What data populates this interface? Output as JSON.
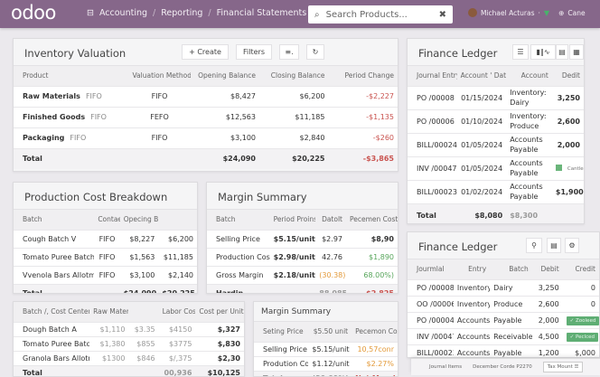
{
  "topbar": {
    "logo": "odoo",
    "breadcrumb": [
      "Accounting",
      "Reporting",
      "Financial Statements"
    ],
    "search_placeholder": "Search Products...",
    "user": "Michael Acturas",
    "company": "Cane",
    "brand_color": "#86678a"
  },
  "inventory": {
    "title": "Inventory Valuation",
    "create": "+ Create",
    "filters": "Filters",
    "columns": [
      "Product",
      "Valuation Method",
      "Opening Balance",
      "Closing Balance",
      "Period Change"
    ],
    "rows": [
      [
        {
          "v": "Raw Materials",
          "sub": "FIFO",
          "tone": "b"
        },
        {
          "v": "FIFO",
          "tone": "c"
        },
        {
          "v": "$8,427"
        },
        {
          "v": "$6,200"
        },
        {
          "v": "-$2,227",
          "tone": "neg"
        }
      ],
      [
        {
          "v": "Finished Goods",
          "sub": "FIFO",
          "tone": "b"
        },
        {
          "v": "FEFO",
          "tone": "c"
        },
        {
          "v": "$12,563"
        },
        {
          "v": "$11,185"
        },
        {
          "v": "-$1,135",
          "tone": "neg"
        }
      ],
      [
        {
          "v": "Packaging",
          "sub": "FIFO",
          "tone": "b"
        },
        {
          "v": "FIFO",
          "tone": "c"
        },
        {
          "v": "$3,100"
        },
        {
          "v": "$2,840"
        },
        {
          "v": "-$260",
          "tone": "neg"
        }
      ]
    ],
    "total": [
      {
        "v": "Total"
      },
      {
        "v": ""
      },
      {
        "v": "$24,090"
      },
      {
        "v": "$20,225"
      },
      {
        "v": "-$3,865",
        "tone": "neg"
      }
    ]
  },
  "ledger1": {
    "title": "Finance Ledger",
    "columns": [
      "Journal Entry",
      "Account ' Date",
      "Account",
      "Dedit"
    ],
    "rows": [
      [
        {
          "v": "PO /00008"
        },
        {
          "v": "01/15/2024"
        },
        {
          "v": "Inventory: Dairy",
          "tone": "l wrap"
        },
        {
          "v": "3,250",
          "tone": "b"
        }
      ],
      [
        {
          "v": "PO /00006"
        },
        {
          "v": "01/10/2024"
        },
        {
          "v": "Inventory: Produce",
          "tone": "l wrap"
        },
        {
          "v": "2,600",
          "tone": "b"
        }
      ],
      [
        {
          "v": "BILL/00024"
        },
        {
          "v": "01/05/2024"
        },
        {
          "v": "Accounts Payable",
          "tone": "l wrap"
        },
        {
          "v": "2,000",
          "tone": "b"
        }
      ],
      [
        {
          "v": "INV /00047"
        },
        {
          "v": "01/05/2024"
        },
        {
          "v": "Accounts Payable",
          "tone": "l wrap"
        },
        {
          "v": "Cantled",
          "tone": "chkbadge"
        }
      ],
      [
        {
          "v": "BILL/00023"
        },
        {
          "v": "01/02/2024"
        },
        {
          "v": "Accounts Payable",
          "tone": "l wrap"
        },
        {
          "v": "$1,900",
          "tone": "b"
        }
      ]
    ],
    "total": [
      {
        "v": "Total"
      },
      {
        "v": "$8,080"
      },
      {
        "v": "$8,300",
        "tone": "l muted"
      },
      {
        "v": ""
      }
    ]
  },
  "production": {
    "title": "Production Cost Breakdown",
    "columns": [
      "Batch",
      "Contaent",
      "Opecing Balance",
      ""
    ],
    "rows": [
      [
        {
          "v": "Cough Batch V"
        },
        {
          "v": "FIFO",
          "tone": "c"
        },
        {
          "v": "$8,227"
        },
        {
          "v": "$6,200"
        }
      ],
      [
        {
          "v": "Tomato Puree Batch"
        },
        {
          "v": "FIFO",
          "tone": "c"
        },
        {
          "v": "$1,563"
        },
        {
          "v": "$11,185"
        }
      ],
      [
        {
          "v": "Vvenola Bars Allotment"
        },
        {
          "v": "FIFO",
          "tone": "c"
        },
        {
          "v": "$3,100"
        },
        {
          "v": "$2,140"
        }
      ]
    ],
    "total": [
      {
        "v": "Total"
      },
      {
        "v": ""
      },
      {
        "v": "$24,090"
      },
      {
        "v": "$20,225"
      }
    ]
  },
  "margin1": {
    "title": "Margin Summary",
    "columns": [
      "Batch",
      "Period Proins",
      "Datolt",
      "Pecemen Cost"
    ],
    "rows": [
      [
        {
          "v": "Selling Price"
        },
        {
          "v": "$5.15/unit",
          "tone": "b"
        },
        {
          "v": "$2.97"
        },
        {
          "v": "$8,90",
          "tone": "b"
        }
      ],
      [
        {
          "v": "Production Cost"
        },
        {
          "v": "$2.98/unit",
          "tone": "b"
        },
        {
          "v": "42.76"
        },
        {
          "v": "$1,890",
          "tone": "pos"
        }
      ],
      [
        {
          "v": "Gross Margin"
        },
        {
          "v": "$2.18/unit",
          "tone": "b"
        },
        {
          "v": "(30.38)",
          "tone": "warn"
        },
        {
          "v": "68.00%)",
          "tone": "pos"
        }
      ]
    ],
    "total": [
      {
        "v": "Hardin"
      },
      {
        "v": ""
      },
      {
        "v": "88,085",
        "tone": "muted"
      },
      {
        "v": "$2,825",
        "tone": "neg"
      }
    ]
  },
  "ledger2": {
    "title": "Finance Ledger",
    "columns": [
      "Jourmlal",
      "Entry",
      "Batch",
      "Debit",
      "Credit"
    ],
    "rows": [
      [
        {
          "v": "PO /00008"
        },
        {
          "v": "Inventory:",
          "tone": "l"
        },
        {
          "v": "Dairy",
          "tone": "l"
        },
        {
          "v": "3,250"
        },
        {
          "v": "0"
        }
      ],
      [
        {
          "v": "OO /00006"
        },
        {
          "v": "Inventory:",
          "tone": "l"
        },
        {
          "v": "Produce",
          "tone": "l"
        },
        {
          "v": "2,600"
        },
        {
          "v": "0"
        }
      ],
      [
        {
          "v": "PO /00004"
        },
        {
          "v": "Accounts",
          "tone": "l"
        },
        {
          "v": "Payable",
          "tone": "l"
        },
        {
          "v": "2,000"
        },
        {
          "v": "✓ Zooleed",
          "tone": "badge"
        }
      ],
      [
        {
          "v": "INV /00047"
        },
        {
          "v": "Accounts",
          "tone": "l"
        },
        {
          "v": "Receivable",
          "tone": "l"
        },
        {
          "v": "4,500"
        },
        {
          "v": "✓ Peclced",
          "tone": "badge"
        }
      ],
      [
        {
          "v": "BILL/00023"
        },
        {
          "v": "Accounts",
          "tone": "l"
        },
        {
          "v": "Payable",
          "tone": "l"
        },
        {
          "v": "1,200"
        },
        {
          "v": "$,000"
        }
      ]
    ],
    "strip": {
      "journal_items": "Journal Items",
      "ref": "December Corde P2270",
      "tax": "Tax Mount"
    }
  },
  "costs": {
    "columns": [
      "Batch /, Cost Center",
      "Raw Material Cost",
      "",
      "Labor Cost",
      "Cost per Unit"
    ],
    "rows": [
      [
        {
          "v": "Dough Batch A"
        },
        {
          "v": "$1,110",
          "tone": "muted"
        },
        {
          "v": "$3.35",
          "tone": "muted"
        },
        {
          "v": "$4150",
          "tone": "muted"
        },
        {
          "v": "$,327",
          "tone": "b"
        }
      ],
      [
        {
          "v": "Tomato Puree Batch"
        },
        {
          "v": "$1,380",
          "tone": "muted"
        },
        {
          "v": "$855",
          "tone": "muted"
        },
        {
          "v": "$3775",
          "tone": "muted"
        },
        {
          "v": "$,830",
          "tone": "b"
        }
      ],
      [
        {
          "v": "Granola Bars Allotment"
        },
        {
          "v": "$1300",
          "tone": "muted"
        },
        {
          "v": "$846",
          "tone": "muted"
        },
        {
          "v": "$/,375",
          "tone": "muted"
        },
        {
          "v": "$2,30",
          "tone": "b"
        }
      ]
    ],
    "total": [
      {
        "v": "Total"
      },
      {
        "v": ""
      },
      {
        "v": ""
      },
      {
        "v": "00,936",
        "tone": "muted"
      },
      {
        "v": "$10,125"
      }
    ]
  },
  "margin2": {
    "title": "Margin Summary",
    "columns": [
      "Seting Price",
      "$5.50 unit",
      "Pecemon Cost"
    ],
    "rows": [
      [
        {
          "v": "Selling Price"
        },
        {
          "v": "$5.15/unit"
        },
        {
          "v": "10,57conr",
          "tone": "warn"
        }
      ],
      [
        {
          "v": "Prodution Cost"
        },
        {
          "v": "$1.12/unit"
        },
        {
          "v": "$2.27%",
          "tone": "warn"
        }
      ]
    ],
    "total": [
      {
        "v": "Total",
        "tone": "muted"
      },
      {
        "v": "(30.09%) ■",
        "tone": "muted"
      },
      {
        "v": "Net Margin",
        "tone": "neg"
      }
    ]
  }
}
